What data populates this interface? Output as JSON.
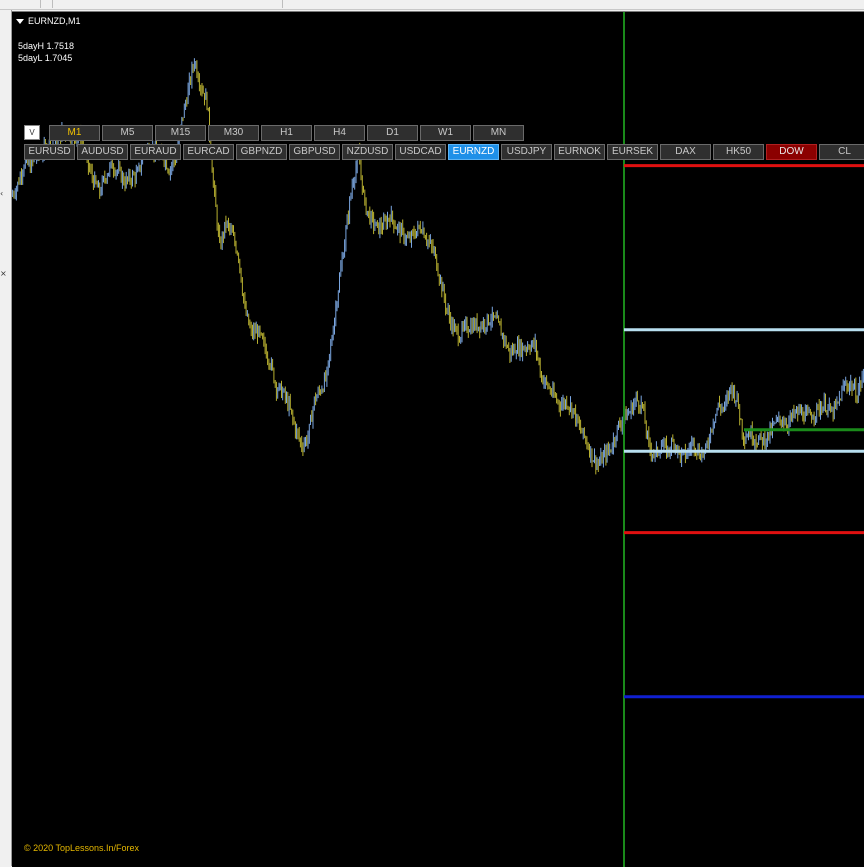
{
  "window": {
    "title": "EURNZD,M1"
  },
  "stats": {
    "high": "5dayH 1.7518",
    "low": "5dayL 1.7045"
  },
  "toggle_label": "V",
  "timeframes": [
    "M1",
    "M5",
    "M15",
    "M30",
    "H1",
    "H4",
    "D1",
    "W1",
    "MN"
  ],
  "active_timeframe": "M1",
  "symbols": [
    "EURUSD",
    "AUDUSD",
    "EURAUD",
    "EURCAD",
    "GBPNZD",
    "GBPUSD",
    "NZDUSD",
    "USDCAD",
    "EURNZD",
    "USDJPY",
    "EURNOK",
    "EURSEK",
    "DAX",
    "HK50",
    "DOW",
    "CL"
  ],
  "active_symbol": "EURNZD",
  "alert_symbol": "DOW",
  "copyright": "© 2020 TopLessons.In/Forex",
  "colors": {
    "background": "#000000",
    "bull": "#7aa6e0",
    "bear": "#b8b030",
    "separator": "#1a8a1a",
    "red_level": "#e01010",
    "lightblue_level": "#b8dff0",
    "green_level": "#1a8a1a",
    "blue_level": "#1020d0",
    "active_symbol_bg": "#1e90e8",
    "alert_symbol_bg": "#8b0000",
    "active_tf_text": "#f2c200"
  },
  "chart_data": {
    "type": "line",
    "price_range": [
      1.7045,
      1.7518
    ],
    "series": [
      {
        "values": [
          1.7326,
          1.7342,
          1.737,
          1.7367,
          1.7379,
          1.7386,
          1.7395,
          1.7395,
          1.7411,
          1.7412,
          1.7406,
          1.7405,
          1.737,
          1.7347,
          1.7331,
          1.7355,
          1.7368,
          1.7358,
          1.7345,
          1.7351,
          1.7355,
          1.7383,
          1.7394,
          1.738,
          1.7382,
          1.7362,
          1.7376,
          1.7427,
          1.7467,
          1.7509,
          1.7475,
          1.7453,
          1.7343,
          1.7257,
          1.729,
          1.7274,
          1.7247,
          1.7173,
          1.7142,
          1.7145,
          1.7126,
          1.7104,
          1.707,
          1.7063,
          1.7044,
          1.7014,
          1.6992,
          1.7003,
          1.7052,
          1.7067,
          1.7084,
          1.7151,
          1.7216,
          1.7278,
          1.7342,
          1.7382,
          1.7314,
          1.7294,
          1.7283,
          1.7287,
          1.7301,
          1.7285,
          1.7275,
          1.7266,
          1.7278,
          1.7286,
          1.7266,
          1.725,
          1.7213,
          1.7173,
          1.7149,
          1.7139,
          1.715,
          1.7153,
          1.7153,
          1.7156,
          1.7163,
          1.7156,
          1.7136,
          1.7115,
          1.7124,
          1.7122,
          1.7127,
          1.7126,
          1.7084,
          1.7071,
          1.7057,
          1.7047,
          1.7051,
          1.704,
          1.7015,
          1.7,
          1.6978,
          1.6966,
          1.6979,
          1.6988,
          1.7014,
          1.7029,
          1.7037,
          1.7054,
          1.7044,
          1.699,
          1.6979,
          1.6992,
          1.6984,
          1.6998,
          1.6977,
          1.698,
          1.6997,
          1.6981,
          1.6983,
          1.702,
          1.7045,
          1.7041,
          1.7071,
          1.7053,
          1.7004,
          1.701,
          1.7,
          1.6999,
          1.7005,
          1.7021,
          1.7027,
          1.7021,
          1.7033,
          1.7037,
          1.703,
          1.7034,
          1.7042,
          1.7047,
          1.7034,
          1.7048,
          1.7073,
          1.7074,
          1.706,
          1.7087
        ]
      }
    ],
    "levels": [
      {
        "price": 1.7367,
        "color": "red"
      },
      {
        "price": 1.7147,
        "color": "lightblue"
      },
      {
        "price": 1.7013,
        "color": "green"
      },
      {
        "price": 1.6984,
        "color": "lightblue"
      },
      {
        "price": 1.6875,
        "color": "red"
      },
      {
        "price": 1.6655,
        "color": "blue"
      }
    ],
    "grid": false
  }
}
